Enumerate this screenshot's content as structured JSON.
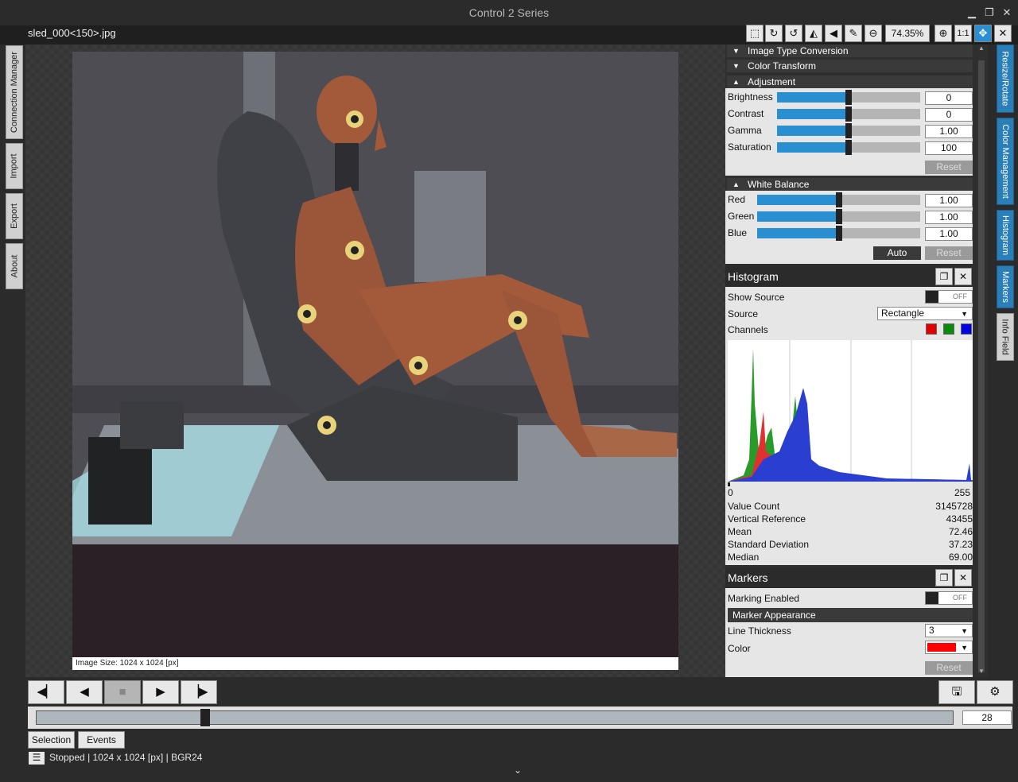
{
  "window": {
    "title": "Control 2 Series",
    "minimize_icon": "minimize-icon",
    "restore_icon": "restore-icon",
    "close_icon": "close-icon"
  },
  "file": {
    "name": "sled_000<150>.jpg"
  },
  "toolbar": {
    "zoom": "74.35%",
    "icons": [
      "selection-icon",
      "rotate-cw-icon",
      "rotate-ccw-icon",
      "flip-horizontal-icon",
      "flip-vertical-icon",
      "eyedropper-icon",
      "zoom-out-icon",
      "zoom-in-icon",
      "actual-size-icon",
      "move-icon",
      "close-icon"
    ],
    "actual_size_label": "1:1"
  },
  "left_tabs": [
    "Connection Manager",
    "Import",
    "Export",
    "About"
  ],
  "viewer": {
    "image_size": "Image Size: 1024 x 1024 [px]"
  },
  "right_tabs": [
    "Resize/Rotate",
    "Color Management",
    "Histogram",
    "Markers",
    "Info Field"
  ],
  "color_panel": {
    "sections": {
      "image_type": "Image Type Conversion",
      "color_transform": "Color Transform",
      "adjustment": "Adjustment",
      "white_balance": "White Balance"
    },
    "adjustment": [
      {
        "label": "Brightness",
        "value": "0",
        "level": 0.5
      },
      {
        "label": "Contrast",
        "value": "0",
        "level": 0.5
      },
      {
        "label": "Gamma",
        "value": "1.00",
        "level": 0.5
      },
      {
        "label": "Saturation",
        "value": "100",
        "level": 0.5
      }
    ],
    "adjustment_reset": "Reset",
    "white_balance": [
      {
        "label": "Red",
        "value": "1.00",
        "level": 0.5
      },
      {
        "label": "Green",
        "value": "1.00",
        "level": 0.5
      },
      {
        "label": "Blue",
        "value": "1.00",
        "level": 0.5
      }
    ],
    "wb_auto": "Auto",
    "wb_reset": "Reset"
  },
  "histogram": {
    "title": "Histogram",
    "show_source_label": "Show Source",
    "show_source_state": "OFF",
    "source_label": "Source",
    "source_value": "Rectangle",
    "channels_label": "Channels",
    "channel_colors": [
      "#e00000",
      "#0a8a0a",
      "#0000e0"
    ],
    "axis_min": "0",
    "axis_max": "255",
    "stats": [
      {
        "label": "Value Count",
        "value": "3145728"
      },
      {
        "label": "Vertical Reference",
        "value": "43455"
      },
      {
        "label": "Mean",
        "value": "72.46"
      },
      {
        "label": "Standard Deviation",
        "value": "37.23"
      },
      {
        "label": "Median",
        "value": "69.00"
      }
    ]
  },
  "markers": {
    "title": "Markers",
    "marking_enabled_label": "Marking Enabled",
    "marking_enabled_state": "OFF",
    "appearance_header": "Marker Appearance",
    "line_thickness_label": "Line Thickness",
    "line_thickness_value": "3",
    "color_label": "Color",
    "color_value": "#ff0000",
    "reset": "Reset"
  },
  "playback": {
    "frame": "28",
    "position": 0.184,
    "save_icon": "save-icon",
    "settings_icon": "gear-icon"
  },
  "bottom_tabs": [
    "Selection",
    "Events"
  ],
  "status": {
    "state": "Stopped",
    "size": "1024 x 1024 [px]",
    "format": "BGR24",
    "sep": "|"
  }
}
